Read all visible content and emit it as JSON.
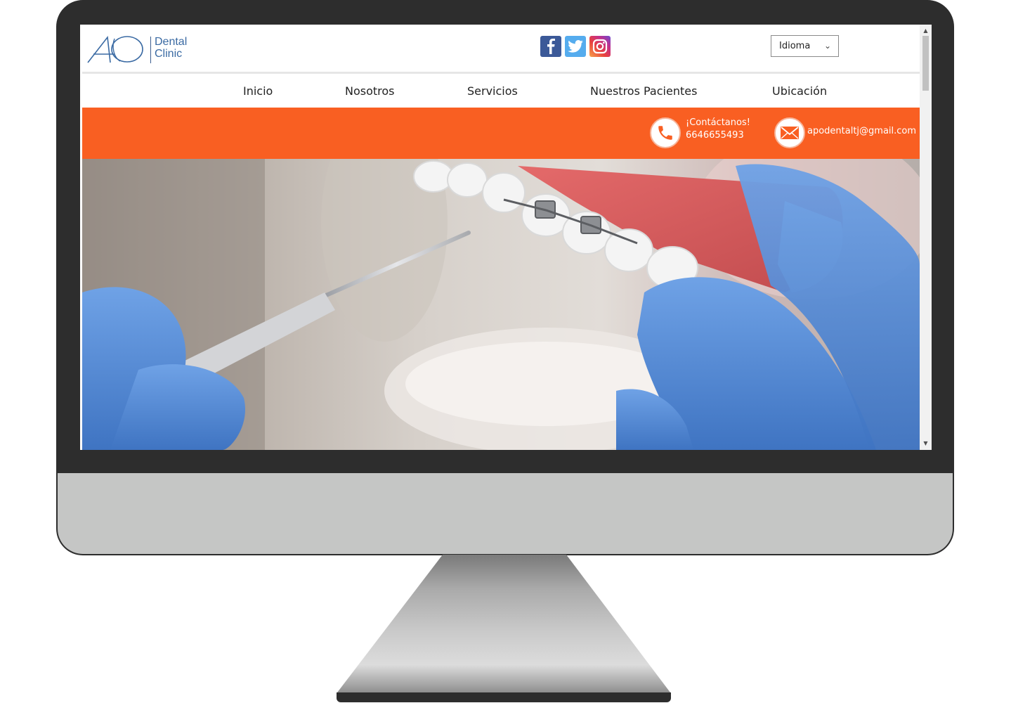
{
  "header": {
    "logo_line1": "Dental",
    "logo_line2": "Clinic",
    "social": [
      "facebook-icon",
      "twitter-icon",
      "instagram-icon"
    ],
    "language_select": "Idioma"
  },
  "nav": {
    "items": [
      "Inicio",
      "Nosotros",
      "Servicios",
      "Nuestros Pacientes",
      "Ubicación"
    ]
  },
  "contact": {
    "heading": "¡Contáctanos!",
    "phone": "6646655493",
    "email": "apodentaltj@gmail.com"
  },
  "colors": {
    "accent": "#f95f22",
    "monitor": "#2d2d2d",
    "logo_blue": "#3a6aa3"
  }
}
